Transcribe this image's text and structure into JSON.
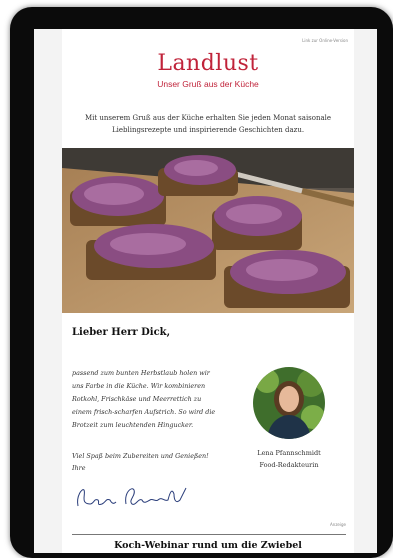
{
  "header": {
    "online_version_link": "Link zur Online-Version",
    "logo_text": "Landlust",
    "logo_subtitle": "Unser Gruß aus der Küche"
  },
  "intro_text": "Mit unserem Gruß aus der Küche erhalten Sie jeden Monat saisonale Lieblingsrezepte und inspirierende Geschichten dazu.",
  "hero_image": {
    "icon": "rotkohl-brot-photo"
  },
  "letter": {
    "greeting": "Lieber Herr Dick,",
    "body_lines": [
      "passend zum bunten Herbstlaub holen wir",
      "uns Farbe in die Küche. Wir kombinieren",
      "Rotkohl, Frischkäse und Meerrettich zu",
      "einem frisch-scharfen Aufstrich. So wird die",
      "Brotzeit zum leuchtenden Hingucker."
    ],
    "closing_lines": [
      "Viel Spaß beim Zubereiten und Genießen!",
      "Ihre"
    ],
    "signature": "Lena Pfannschmidt"
  },
  "author": {
    "name": "Lena Pfannschmidt",
    "role": "Food-Redakteurin"
  },
  "ad_label": "Anzeige",
  "next_section_title": "Koch-Webinar rund um die Zwiebel",
  "colors": {
    "brand": "#c0233a",
    "device_frame": "#0b0b0b"
  }
}
